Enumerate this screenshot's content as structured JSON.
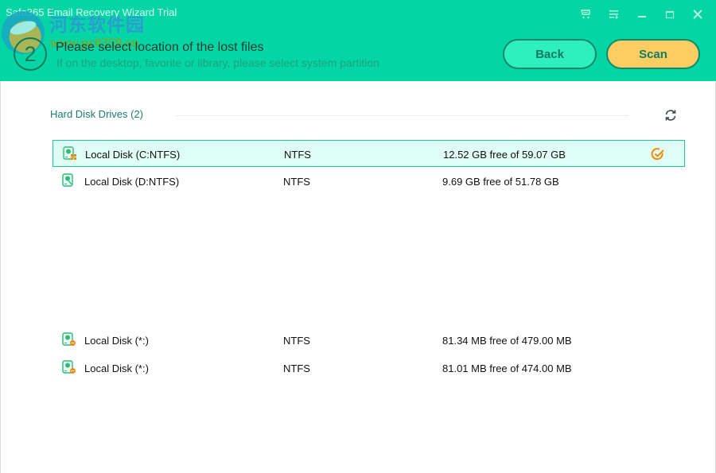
{
  "window": {
    "app_title": "Safe365 Email Recovery Wizard Trial",
    "controls": [
      "cart-icon",
      "menu-icon",
      "minimize-icon",
      "maximize-icon",
      "close-icon"
    ]
  },
  "watermark": {
    "line1": "河东软件园",
    "line2": "www.pc0359.cn"
  },
  "step": {
    "number": "2",
    "title": "Please select location of the lost files",
    "subtitle": "If on the desktop, favorite or library, please select system partition"
  },
  "buttons": {
    "back": "Back",
    "scan": "Scan"
  },
  "colors": {
    "header_bg": "#03D6A4",
    "back_bg": "#2EF0BF",
    "scan_bg": "#FCCD62",
    "selected_row_bg": "#DFFDF4",
    "selected_row_border": "#1CCB98",
    "check_color": "#F28A0C"
  },
  "section": {
    "label": "Hard Disk Drives (2)"
  },
  "drives": [
    {
      "name": "Local Disk (C:NTFS)",
      "fs": "NTFS",
      "size": "12.52 GB free of 59.07 GB",
      "selected": true,
      "icon": "system-drive-icon"
    },
    {
      "name": "Local Disk (D:NTFS)",
      "fs": "NTFS",
      "size": "9.69 GB free of 51.78 GB",
      "selected": false,
      "icon": "drive-icon"
    },
    {
      "name": "Local Disk (*:)",
      "fs": "NTFS",
      "size": "81.34 MB free of 479.00 MB",
      "selected": false,
      "icon": "hidden-drive-icon"
    },
    {
      "name": "Local Disk (*:)",
      "fs": "NTFS",
      "size": "81.01 MB free of 474.00 MB",
      "selected": false,
      "icon": "hidden-drive-icon"
    }
  ]
}
